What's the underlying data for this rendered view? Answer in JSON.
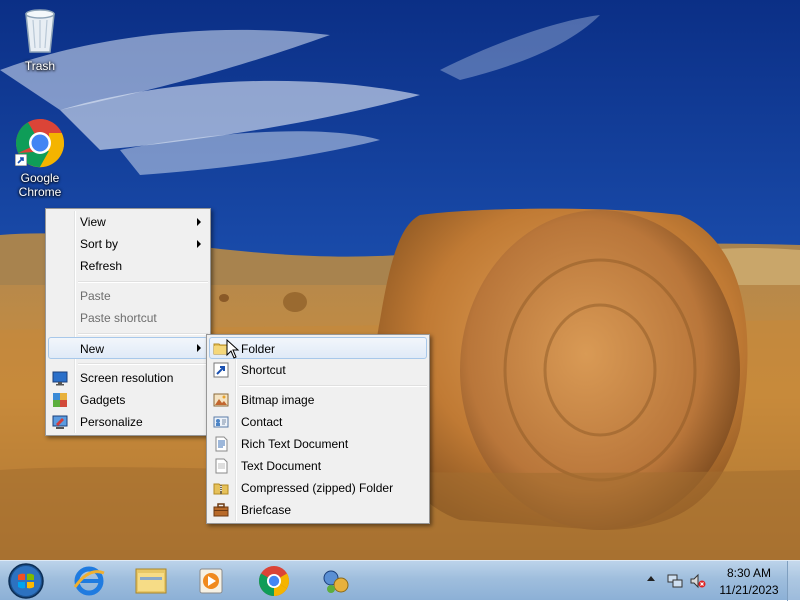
{
  "desktop": {
    "icons": [
      {
        "label": "Trash",
        "icon": "recycle-bin-icon"
      },
      {
        "label": "Google Chrome",
        "icon": "chrome-icon"
      }
    ]
  },
  "context_menu": {
    "items": [
      {
        "label": "View",
        "submenu": true
      },
      {
        "label": "Sort by",
        "submenu": true
      },
      {
        "label": "Refresh"
      },
      {
        "label": "Paste",
        "disabled": true
      },
      {
        "label": "Paste shortcut",
        "disabled": true
      },
      {
        "label": "New",
        "submenu": true,
        "highlighted": true
      },
      {
        "label": "Screen resolution",
        "icon": "screen-resolution-icon"
      },
      {
        "label": "Gadgets",
        "icon": "gadgets-icon"
      },
      {
        "label": "Personalize",
        "icon": "personalize-icon"
      }
    ]
  },
  "new_submenu": {
    "items": [
      {
        "label": "Folder",
        "icon": "folder-icon",
        "highlighted": true
      },
      {
        "label": "Shortcut",
        "icon": "shortcut-icon"
      },
      {
        "label": "Bitmap image",
        "icon": "bitmap-image-icon"
      },
      {
        "label": "Contact",
        "icon": "contact-icon"
      },
      {
        "label": "Rich Text Document",
        "icon": "rich-text-document-icon"
      },
      {
        "label": "Text Document",
        "icon": "text-document-icon"
      },
      {
        "label": "Compressed (zipped) Folder",
        "icon": "zipped-folder-icon"
      },
      {
        "label": "Briefcase",
        "icon": "briefcase-icon"
      }
    ]
  },
  "taskbar": {
    "pinned": [
      "start-orb-icon",
      "internet-explorer-icon",
      "file-explorer-icon",
      "media-player-icon",
      "chrome-icon",
      "gadget-app-icon"
    ],
    "clock": {
      "time": "8:30 AM",
      "date": "11/21/2023"
    }
  }
}
